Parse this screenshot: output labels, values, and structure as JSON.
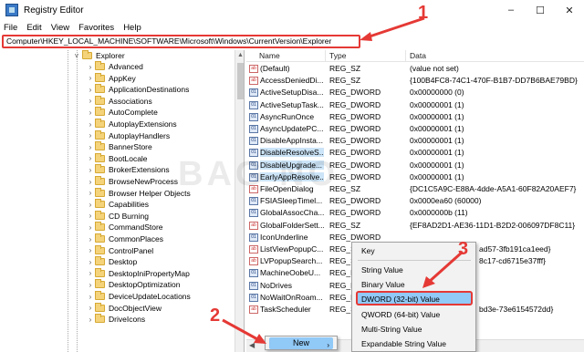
{
  "window": {
    "title": "Registry Editor",
    "controls": [
      "–",
      "☐",
      "✕"
    ]
  },
  "menu": [
    "File",
    "Edit",
    "View",
    "Favorites",
    "Help"
  ],
  "address": "Computer\\HKEY_LOCAL_MACHINE\\SOFTWARE\\Microsoft\\Windows\\CurrentVersion\\Explorer",
  "tree": {
    "root": "Explorer",
    "children": [
      "Advanced",
      "AppKey",
      "ApplicationDestinations",
      "Associations",
      "AutoComplete",
      "AutoplayExtensions",
      "AutoplayHandlers",
      "BannerStore",
      "BootLocale",
      "BrokerExtensions",
      "BrowseNewProcess",
      "Browser Helper Objects",
      "Capabilities",
      "CD Burning",
      "CommandStore",
      "CommonPlaces",
      "ControlPanel",
      "Desktop",
      "DesktopIniPropertyMap",
      "DesktopOptimization",
      "DeviceUpdateLocations",
      "DocObjectView",
      "DriveIcons"
    ]
  },
  "list": {
    "columns": [
      "Name",
      "Type",
      "Data"
    ],
    "rows": [
      {
        "name": "(Default)",
        "type": "REG_SZ",
        "data": "(value not set)",
        "icon": "sz"
      },
      {
        "name": "AccessDeniedDi...",
        "type": "REG_SZ",
        "data": "{100B4FC8-74C1-470F-B1B7-DD7B6BAE79BD}",
        "icon": "sz"
      },
      {
        "name": "ActiveSetupDisa...",
        "type": "REG_DWORD",
        "data": "0x00000000 (0)",
        "icon": "dw"
      },
      {
        "name": "ActiveSetupTask...",
        "type": "REG_DWORD",
        "data": "0x00000001 (1)",
        "icon": "dw"
      },
      {
        "name": "AsyncRunOnce",
        "type": "REG_DWORD",
        "data": "0x00000001 (1)",
        "icon": "dw"
      },
      {
        "name": "AsyncUpdatePC...",
        "type": "REG_DWORD",
        "data": "0x00000001 (1)",
        "icon": "dw"
      },
      {
        "name": "DisableAppInsta...",
        "type": "REG_DWORD",
        "data": "0x00000001 (1)",
        "icon": "dw"
      },
      {
        "name": "DisableResolveS...",
        "type": "REG_DWORD",
        "data": "0x00000001 (1)",
        "icon": "dw"
      },
      {
        "name": "DisableUpgrade...",
        "type": "REG_DWORD",
        "data": "0x00000001 (1)",
        "icon": "dw"
      },
      {
        "name": "EarlyAppResolve...",
        "type": "REG_DWORD",
        "data": "0x00000001 (1)",
        "icon": "dw"
      },
      {
        "name": "FileOpenDialog",
        "type": "REG_SZ",
        "data": "{DC1C5A9C-E88A-4dde-A5A1-60F82A20AEF7}",
        "icon": "sz"
      },
      {
        "name": "FSIASleepTimel...",
        "type": "REG_DWORD",
        "data": "0x0000ea60 (60000)",
        "icon": "dw"
      },
      {
        "name": "GlobalAssocCha...",
        "type": "REG_DWORD",
        "data": "0x0000000b (11)",
        "icon": "dw"
      },
      {
        "name": "GlobalFolderSett...",
        "type": "REG_SZ",
        "data": "{EF8AD2D1-AE36-11D1-B2D2-006097DF8C11}",
        "icon": "sz"
      },
      {
        "name": "IconUnderline",
        "type": "REG_DWORD",
        "data": "",
        "icon": "dw"
      },
      {
        "name": "ListViewPopupC...",
        "type": "REG_SZ",
        "data": "ad57-3fb191ca1eed}",
        "icon": "sz"
      },
      {
        "name": "LVPopupSearch...",
        "type": "REG_SZ",
        "data": "8c17-cd6715e37fff}",
        "icon": "sz"
      },
      {
        "name": "MachineOobeU...",
        "type": "REG_DWORD",
        "data": "",
        "icon": "dw"
      },
      {
        "name": "NoDrives",
        "type": "REG_DWORD",
        "data": "",
        "icon": "dw"
      },
      {
        "name": "NoWaitOnRoam...",
        "type": "REG_DWORD",
        "data": "",
        "icon": "dw"
      },
      {
        "name": "TaskScheduler",
        "type": "REG_SZ",
        "data": "bd3e-73e6154572dd}",
        "icon": "sz"
      }
    ]
  },
  "context_new": {
    "label": "New",
    "chevron": "›"
  },
  "context_sub": {
    "items": [
      "Key",
      "String Value",
      "Binary Value",
      "DWORD (32-bit) Value",
      "QWORD (64-bit) Value",
      "Multi-String Value",
      "Expandable String Value"
    ]
  },
  "callouts": [
    "1",
    "2",
    "3"
  ],
  "watermark": "BAG     NO",
  "colors": {
    "accent": "#e53935",
    "highlight": "#91c9f7",
    "selection": "#cce4f7"
  }
}
